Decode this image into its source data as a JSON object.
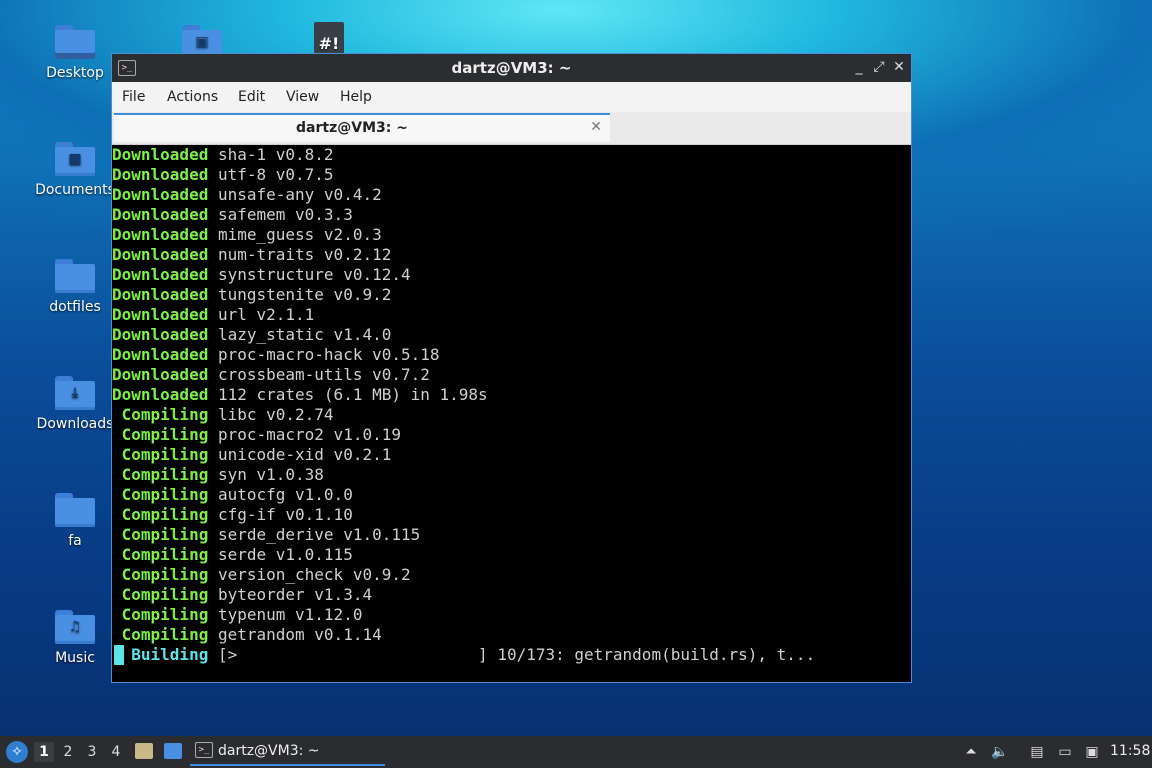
{
  "desktop": {
    "icons": [
      {
        "label": "Desktop",
        "icon": "folder-desktop-icon"
      },
      {
        "label": "Documents",
        "icon": "folder-documents-icon"
      },
      {
        "label": "dotfiles",
        "icon": "folder-icon"
      },
      {
        "label": "Downloads",
        "icon": "folder-downloads-icon"
      },
      {
        "label": "fa",
        "icon": "folder-icon"
      },
      {
        "label": "Music",
        "icon": "folder-music-icon"
      }
    ]
  },
  "window": {
    "title": "dartz@VM3: ~",
    "menu": [
      "File",
      "Actions",
      "Edit",
      "View",
      "Help"
    ],
    "tab_title": "dartz@VM3: ~",
    "controls": {
      "minimize": "_",
      "maximize": "⤢",
      "close": "✕"
    }
  },
  "terminal": {
    "lines": [
      {
        "kw": "Downloaded",
        "text": " sha-1 v0.8.2"
      },
      {
        "kw": "Downloaded",
        "text": " utf-8 v0.7.5"
      },
      {
        "kw": "Downloaded",
        "text": " unsafe-any v0.4.2"
      },
      {
        "kw": "Downloaded",
        "text": " safemem v0.3.3"
      },
      {
        "kw": "Downloaded",
        "text": " mime_guess v2.0.3"
      },
      {
        "kw": "Downloaded",
        "text": " num-traits v0.2.12"
      },
      {
        "kw": "Downloaded",
        "text": " synstructure v0.12.4"
      },
      {
        "kw": "Downloaded",
        "text": " tungstenite v0.9.2"
      },
      {
        "kw": "Downloaded",
        "text": " url v2.1.1"
      },
      {
        "kw": "Downloaded",
        "text": " lazy_static v1.4.0"
      },
      {
        "kw": "Downloaded",
        "text": " proc-macro-hack v0.5.18"
      },
      {
        "kw": "Downloaded",
        "text": " crossbeam-utils v0.7.2"
      },
      {
        "kw": "Downloaded",
        "text": " 112 crates (6.1 MB) in 1.98s"
      },
      {
        "kw": " Compiling",
        "text": " libc v0.2.74"
      },
      {
        "kw": " Compiling",
        "text": " proc-macro2 v1.0.19"
      },
      {
        "kw": " Compiling",
        "text": " unicode-xid v0.2.1"
      },
      {
        "kw": " Compiling",
        "text": " syn v1.0.38"
      },
      {
        "kw": " Compiling",
        "text": " autocfg v1.0.0"
      },
      {
        "kw": " Compiling",
        "text": " cfg-if v0.1.10"
      },
      {
        "kw": " Compiling",
        "text": " serde_derive v1.0.115"
      },
      {
        "kw": " Compiling",
        "text": " serde v1.0.115"
      },
      {
        "kw": " Compiling",
        "text": " version_check v0.9.2"
      },
      {
        "kw": " Compiling",
        "text": " byteorder v1.3.4"
      },
      {
        "kw": " Compiling",
        "text": " typenum v1.12.0"
      },
      {
        "kw": " Compiling",
        "text": " getrandom v0.1.14"
      }
    ],
    "building": {
      "kw": "  Building",
      "text": " [>                         ] 10/173: getrandom(build.rs), t..."
    }
  },
  "taskbar": {
    "workspaces": [
      "1",
      "2",
      "3",
      "4"
    ],
    "active_workspace": "1",
    "task_label": "dartz@VM3: ~",
    "clock": "11:58"
  },
  "colors": {
    "accent": "#3d8ee0",
    "terminal_green": "#7ef04a",
    "terminal_cyan": "#5ce4e8"
  }
}
